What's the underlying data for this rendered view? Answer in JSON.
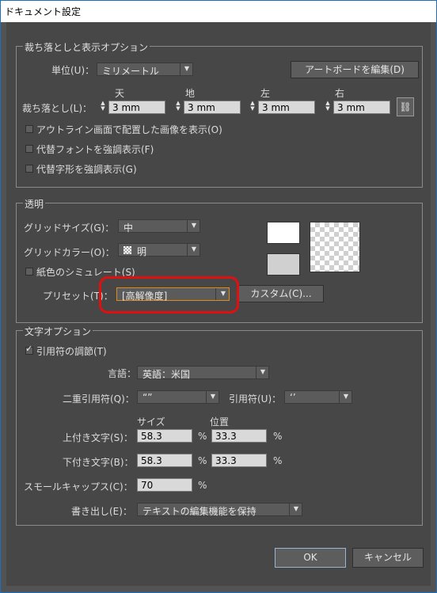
{
  "window": {
    "title": "ドキュメント設定"
  },
  "bleed": {
    "legend": "裁ち落としと表示オプション",
    "units_label": "単位(U)：",
    "units_value": "ミリメートル",
    "artboard_button": "アートボードを編集(D)",
    "bleed_label": "裁ち落とし(L)：",
    "headers": {
      "top": "天",
      "bottom": "地",
      "left": "左",
      "right": "右"
    },
    "values": {
      "top": "3 mm",
      "bottom": "3 mm",
      "left": "3 mm",
      "right": "3 mm"
    },
    "opt_outline": "アウトライン画面で配置した画像を表示(O)",
    "opt_font": "代替フォントを強調表示(F)",
    "opt_glyph": "代替字形を強調表示(G)"
  },
  "transparency": {
    "legend": "透明",
    "grid_size_label": "グリッドサイズ(G)：",
    "grid_size_value": "中",
    "grid_color_label": "グリッドカラー(O)：",
    "grid_color_value": "明",
    "paper_sim": "紙色のシミュレート(S)",
    "preset_label": "プリセット(T)：",
    "preset_value": "[高解像度]",
    "custom_button": "カスタム(C)..."
  },
  "text": {
    "legend": "文字オプション",
    "quotes_label": "引用符の調節(T)",
    "language_label": "言語：",
    "language_value": "英語：米国",
    "double_quotes_label": "二重引用符(Q)：",
    "double_quotes_value": "“”",
    "single_quotes_label": "引用符(U)：",
    "single_quotes_value": "‘’",
    "size_header": "サイズ",
    "position_header": "位置",
    "superscript_label": "上付き文字(S)：",
    "superscript_size": "58.3",
    "superscript_position": "33.3",
    "subscript_label": "下付き文字(B)：",
    "subscript_size": "58.3",
    "subscript_position": "33.3",
    "smallcaps_label": "スモールキャップス(C)：",
    "smallcaps_value": "70",
    "percent": "%",
    "export_label": "書き出し(E)：",
    "export_value": "テキストの編集機能を保持"
  },
  "buttons": {
    "ok": "OK",
    "cancel": "キャンセル"
  },
  "colors": {
    "highlight": "#e01010",
    "panel": "#474747"
  }
}
